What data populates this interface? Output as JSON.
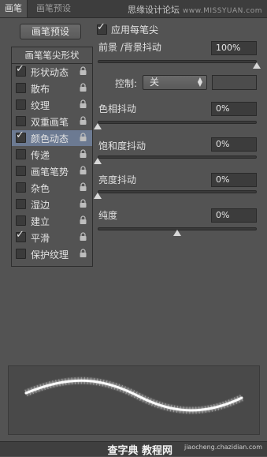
{
  "tabs": [
    {
      "label": "画笔",
      "active": true
    },
    {
      "label": "画笔预设",
      "active": false
    }
  ],
  "watermark": {
    "cn": "思缘设计论坛",
    "en": "www.MISSYUAN.com"
  },
  "preset_button": "画笔预设",
  "list": {
    "header": "画笔笔尖形状",
    "items": [
      {
        "label": "形状动态",
        "checked": true,
        "selected": false
      },
      {
        "label": "散布",
        "checked": false,
        "selected": false
      },
      {
        "label": "纹理",
        "checked": false,
        "selected": false
      },
      {
        "label": "双重画笔",
        "checked": false,
        "selected": false
      },
      {
        "label": "颜色动态",
        "checked": true,
        "selected": true
      },
      {
        "label": "传递",
        "checked": false,
        "selected": false
      },
      {
        "label": "画笔笔势",
        "checked": false,
        "selected": false
      },
      {
        "label": "杂色",
        "checked": false,
        "selected": false
      },
      {
        "label": "湿边",
        "checked": false,
        "selected": false
      },
      {
        "label": "建立",
        "checked": false,
        "selected": false
      },
      {
        "label": "平滑",
        "checked": true,
        "selected": false
      },
      {
        "label": "保护纹理",
        "checked": false,
        "selected": false
      }
    ]
  },
  "apply_per_tip": {
    "label": "应用每笔尖",
    "checked": true
  },
  "fg_bg_jitter": {
    "label": "前景 /背景抖动",
    "value": "100%",
    "level": 1.0
  },
  "control": {
    "label": "控制:",
    "value": "关"
  },
  "hue_jitter": {
    "label": "色相抖动",
    "value": "0%",
    "level": 0.0
  },
  "saturation_jitter": {
    "label": "饱和度抖动",
    "value": "0%",
    "level": 0.0
  },
  "brightness_jitter": {
    "label": "亮度抖动",
    "value": "0%",
    "level": 0.0
  },
  "purity": {
    "label": "纯度",
    "value": "0%",
    "level": 0.5
  },
  "bottom_watermark": {
    "logo": "查字典 教程网",
    "sub": "jiaocheng.chazidian.com"
  }
}
